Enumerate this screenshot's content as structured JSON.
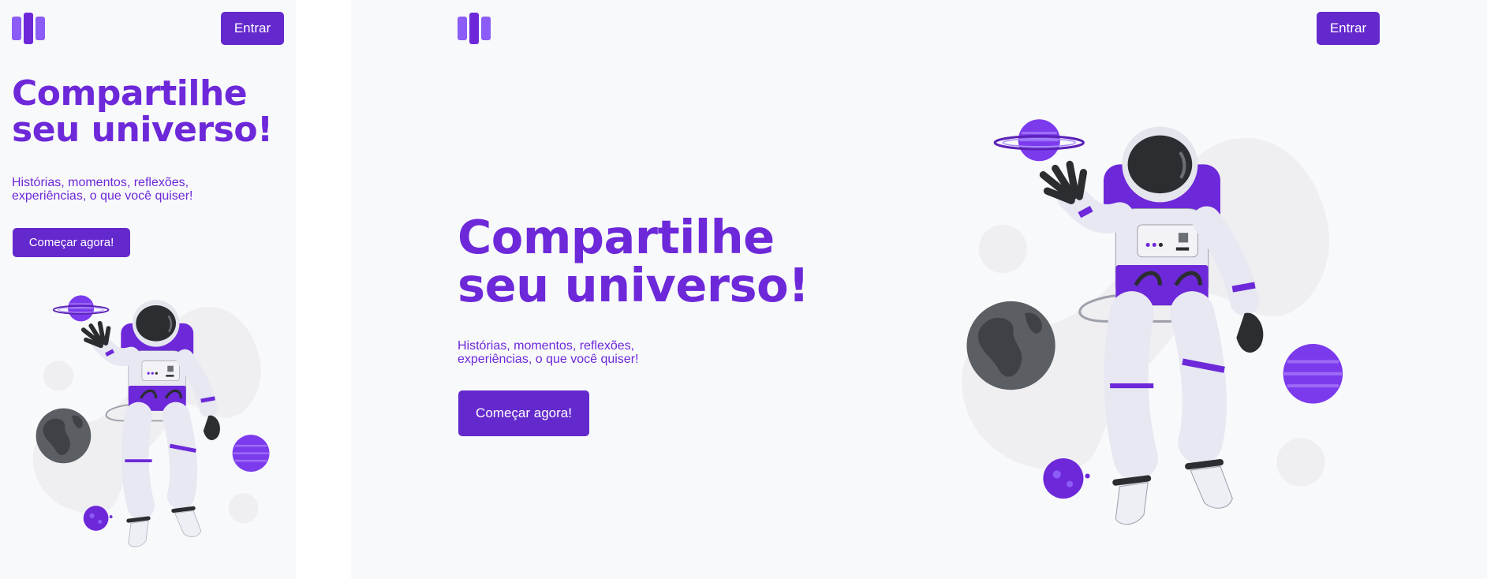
{
  "mobile": {
    "login_label": "Entrar",
    "headline": [
      "Compartilhe",
      "seu universo!"
    ],
    "subtitle": [
      "Histórias, momentos, reflexões,",
      "experiências, o que você quiser!"
    ],
    "cta_label": "Começar agora!"
  },
  "desktop": {
    "login_label": "Entrar",
    "headline": [
      "Compartilhe",
      "seu universo!"
    ],
    "subtitle": [
      "Histórias, momentos, reflexões,",
      "experiências, o que você quiser!"
    ],
    "cta_label": "Começar agora!"
  },
  "colors": {
    "primary": "#6429cd",
    "headline": "#6d28d9",
    "background": "#f8f9fb"
  },
  "icons": [
    "app-logo-icon",
    "astronaut-illustration",
    "ringed-planet-icon",
    "earth-planet-icon",
    "purple-planet-icon"
  ]
}
